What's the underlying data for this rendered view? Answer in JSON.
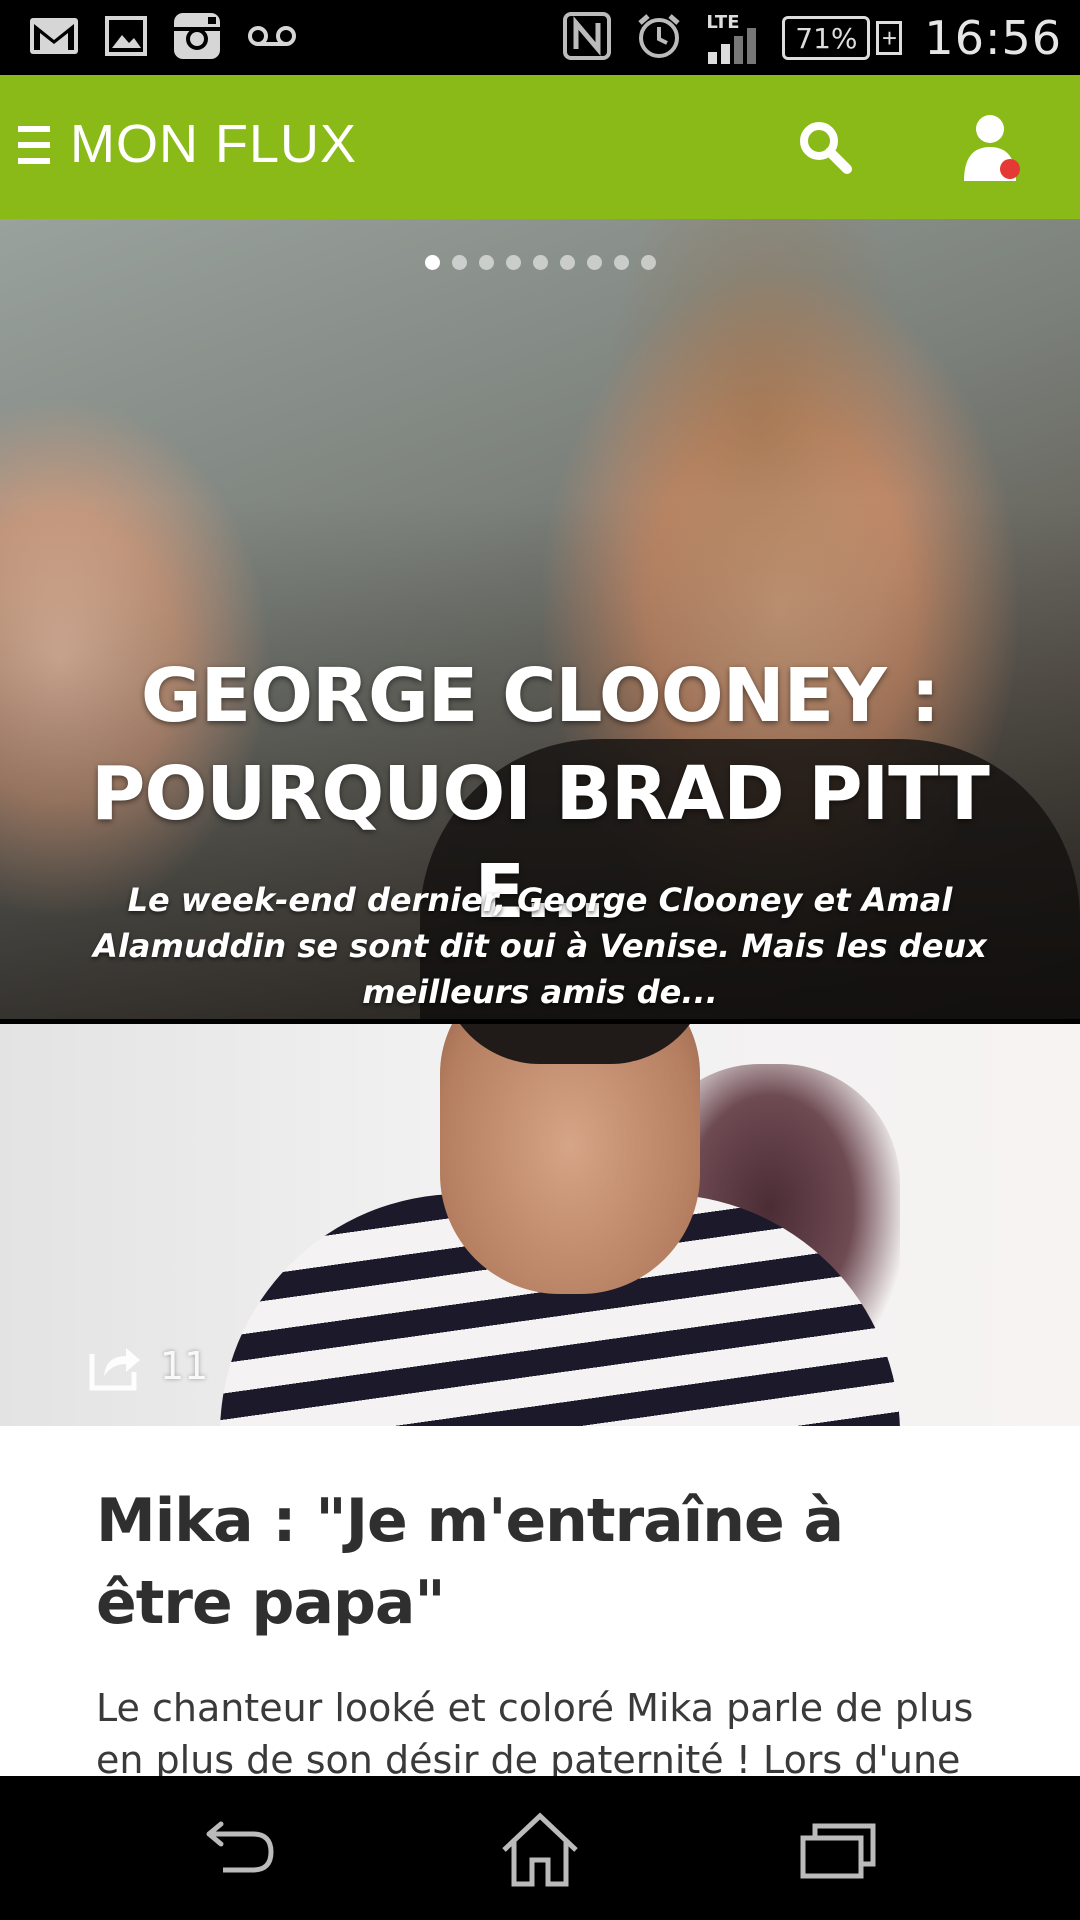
{
  "status_bar": {
    "icons": [
      "gmail-icon",
      "gallery-icon",
      "instagram-icon",
      "voicemail-icon",
      "nfc-icon",
      "alarm-icon",
      "lte-signal-icon"
    ],
    "network_label": "LTE",
    "battery": "71%",
    "battery_plus": "+",
    "time": "16:56"
  },
  "app_bar": {
    "title": "MON FLUX",
    "color": "#8aba17",
    "badge_color": "#e53935"
  },
  "hero": {
    "title": "GEORGE CLOONEY : POURQUOI BRAD PITT E...",
    "subtitle": "Le week-end dernier, George Clooney et Amal Alamuddin se sont dit oui à Venise. Mais les deux meilleurs amis de...",
    "pagination": {
      "total": 9,
      "current": 1
    }
  },
  "article": {
    "share_count": "11",
    "title": "Mika : \"Je m'entraîne à être papa\"",
    "excerpt": "Le chanteur looké et coloré Mika parle de plus en plus de son désir de paternité ! Lors d'une"
  },
  "nav_bar": {
    "buttons": [
      "back-icon",
      "home-icon",
      "recent-apps-icon"
    ]
  }
}
